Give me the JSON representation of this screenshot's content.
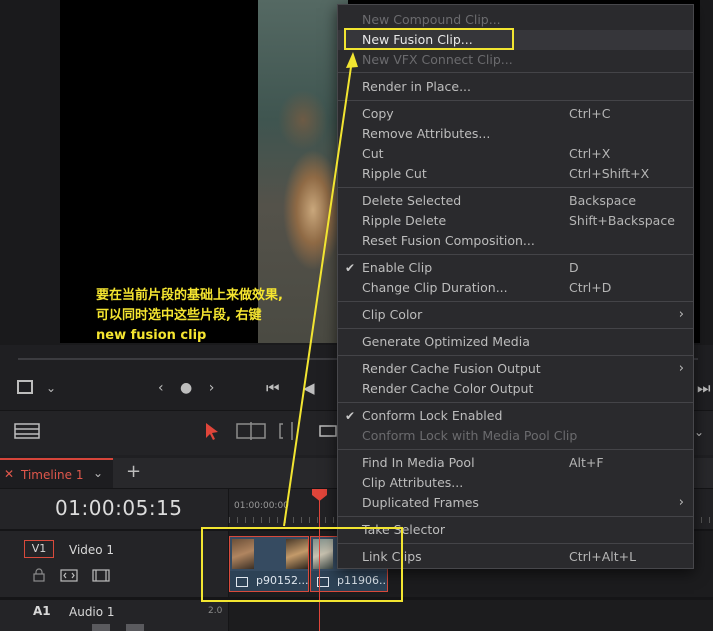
{
  "viewer": {
    "nav_dots": "‹ ● ›"
  },
  "timeline": {
    "tab_label": "Timeline 1",
    "add_tab": "+",
    "timecode": "01:00:05:15",
    "ruler_label": "01:00:00:00",
    "tracks": [
      {
        "id": "V1",
        "name": "Video 1"
      },
      {
        "id": "A1",
        "name": "Audio 1",
        "level": "2.0"
      }
    ],
    "clips": [
      {
        "name": "p90152..."
      },
      {
        "name": "p11906..."
      }
    ]
  },
  "annotation": {
    "line1": "要在当前片段的基础上来做效果,",
    "line2": "可以同时选中这些片段, 右键",
    "line3": "new fusion clip"
  },
  "context_menu": {
    "items": [
      {
        "label": "New Compound Clip...",
        "shortcut": ""
      },
      {
        "label": "New Fusion Clip...",
        "shortcut": ""
      },
      {
        "label": "New VFX Connect Clip...",
        "shortcut": ""
      },
      {
        "label": "Render in Place...",
        "shortcut": ""
      },
      {
        "label": "Copy",
        "shortcut": "Ctrl+C"
      },
      {
        "label": "Remove Attributes...",
        "shortcut": ""
      },
      {
        "label": "Cut",
        "shortcut": "Ctrl+X"
      },
      {
        "label": "Ripple Cut",
        "shortcut": "Ctrl+Shift+X"
      },
      {
        "label": "Delete Selected",
        "shortcut": "Backspace"
      },
      {
        "label": "Ripple Delete",
        "shortcut": "Shift+Backspace"
      },
      {
        "label": "Reset Fusion Composition...",
        "shortcut": ""
      },
      {
        "label": "Enable Clip",
        "shortcut": "D"
      },
      {
        "label": "Change Clip Duration...",
        "shortcut": "Ctrl+D"
      },
      {
        "label": "Clip Color",
        "shortcut": ""
      },
      {
        "label": "Generate Optimized Media",
        "shortcut": ""
      },
      {
        "label": "Render Cache Fusion Output",
        "shortcut": ""
      },
      {
        "label": "Render Cache Color Output",
        "shortcut": ""
      },
      {
        "label": "Conform Lock Enabled",
        "shortcut": ""
      },
      {
        "label": "Conform Lock with Media Pool Clip",
        "shortcut": ""
      },
      {
        "label": "Find In Media Pool",
        "shortcut": "Alt+F"
      },
      {
        "label": "Clip Attributes...",
        "shortcut": ""
      },
      {
        "label": "Duplicated Frames",
        "shortcut": ""
      },
      {
        "label": "Take Selector",
        "shortcut": ""
      },
      {
        "label": "Link Clips",
        "shortcut": "Ctrl+Alt+L"
      }
    ]
  },
  "colors": {
    "highlight": "#f2e531",
    "playhead": "#e0453a",
    "clip_border": "#d84a3c",
    "clip_fill": "#364b61"
  }
}
